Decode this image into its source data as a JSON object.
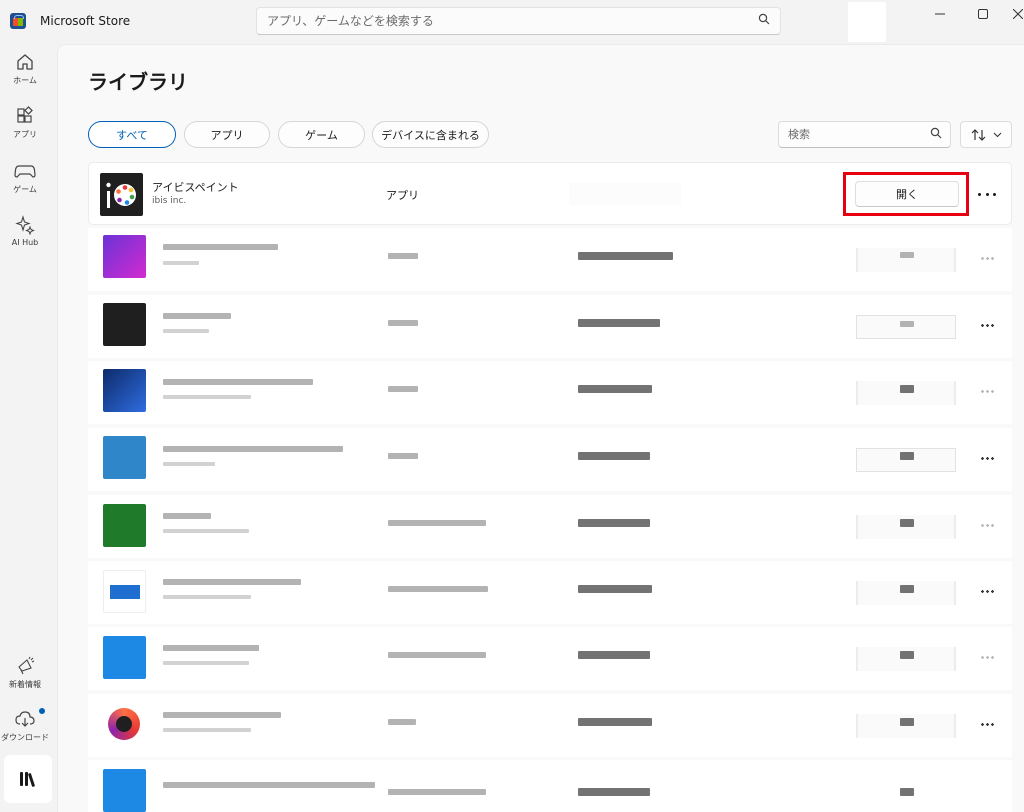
{
  "app": {
    "title": "Microsoft Store"
  },
  "search": {
    "placeholder": "アプリ、ゲームなどを検索する"
  },
  "nav": {
    "items": [
      {
        "label": "ホーム",
        "icon": "home-icon"
      },
      {
        "label": "アプリ",
        "icon": "apps-icon"
      },
      {
        "label": "ゲーム",
        "icon": "gamepad-icon"
      },
      {
        "label": "AI Hub",
        "icon": "sparkle-icon"
      }
    ],
    "bottom": [
      {
        "label": "新着情報",
        "icon": "megaphone-icon"
      },
      {
        "label": "ダウンロード",
        "icon": "cloud-download-icon"
      }
    ],
    "active_icon": "library-icon"
  },
  "page": {
    "title": "ライブラリ"
  },
  "filters": {
    "chips": [
      {
        "label": "すべて",
        "selected": true
      },
      {
        "label": "アプリ",
        "selected": false
      },
      {
        "label": "ゲーム",
        "selected": false
      },
      {
        "label": "デバイスに含まれる",
        "selected": false
      }
    ],
    "search_placeholder": "検索",
    "sort_icon": "sort-arrows-icon"
  },
  "library": {
    "first": {
      "name": "アイビスペイント",
      "publisher": "ibis inc.",
      "type": "アプリ",
      "action": "開く",
      "icon": "ibis-paint-icon"
    }
  },
  "colors": {
    "accent": "#005fb8",
    "highlight": "#e60012",
    "thumbs": [
      "#a12be0",
      "#1f1f1f",
      "#1a3c8a",
      "#2f86c9",
      "#1f7a2a",
      "#ffffff",
      "#1e88e5",
      "#ffffff",
      "#1e88e5"
    ]
  }
}
